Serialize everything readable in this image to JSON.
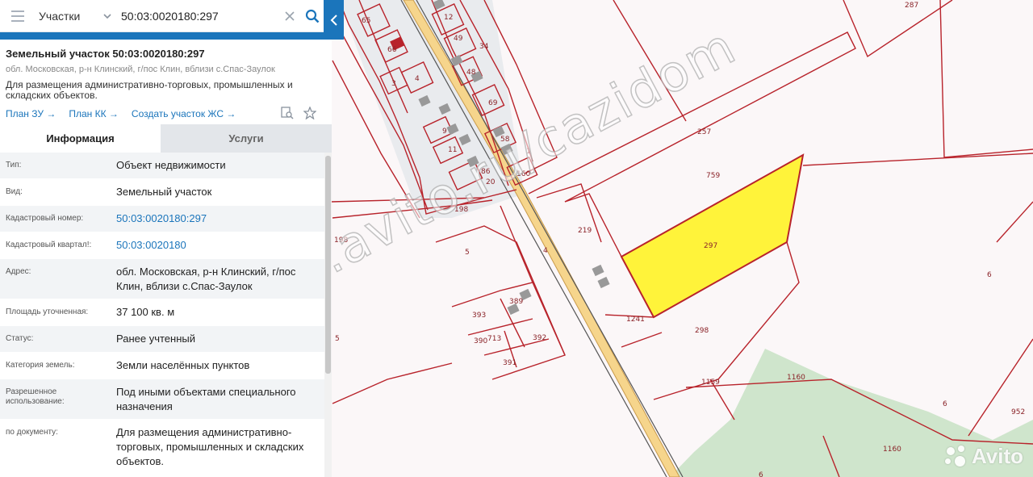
{
  "search": {
    "type_label": "Участки",
    "query": "50:03:0020180:297"
  },
  "card": {
    "title": "Земельный участок 50:03:0020180:297",
    "address_short": "обл. Московская, р-н Клинский, г/пос Клин, вблизи с.Спас-Заулок",
    "purpose": "Для размещения административно-торговых, промышленных и складских объектов.",
    "links": [
      "План ЗУ →",
      "План КК →",
      "Создать участок ЖС →"
    ]
  },
  "tabs": [
    "Информация",
    "Услуги"
  ],
  "rows": [
    {
      "label": "Тип:",
      "value": "Объект недвижимости"
    },
    {
      "label": "Вид:",
      "value": "Земельный участок"
    },
    {
      "label": "Кадастровый номер:",
      "value": "50:03:0020180:297"
    },
    {
      "label": "Кадастровый квартал!:",
      "value": "50:03:0020180"
    },
    {
      "label": "Адрес:",
      "value": "обл. Московская, р-н Клинский, г/пос Клин, вблизи с.Спас-Заулок"
    },
    {
      "label": "Площадь уточненная:",
      "value": "37 100 кв. м"
    },
    {
      "label": "Статус:",
      "value": "Ранее учтенный"
    },
    {
      "label": "Категория земель:",
      "value": "Земли населённых пунктов"
    },
    {
      "label": "Разрешенное использование:",
      "value": "Под иными объектами специального назначения"
    },
    {
      "label": "по документу:",
      "value": "Для размещения административно-торговых, промышленных и складских объектов."
    }
  ],
  "map": {
    "parcel_labels": [
      "65",
      "12",
      "49",
      "34",
      "66",
      "3",
      "4",
      "48",
      "69",
      "9",
      "58",
      "1",
      "11",
      "86",
      "20",
      "160",
      "198",
      "198",
      "5",
      "4",
      "219",
      "297",
      "257",
      "759",
      "287",
      "6",
      "6",
      "1241",
      "298",
      "393",
      "389",
      "390",
      "713",
      "392",
      "391",
      "5",
      "1159",
      "1160",
      "1160",
      "952",
      "6"
    ],
    "watermark": "www.avito.ru/cazidom",
    "logo_text": "Avito"
  },
  "colors": {
    "accent": "#1b75bb",
    "parcel_border": "#b8232b",
    "selected_fill": "#fff33a",
    "forest": "#cfe5cc"
  }
}
